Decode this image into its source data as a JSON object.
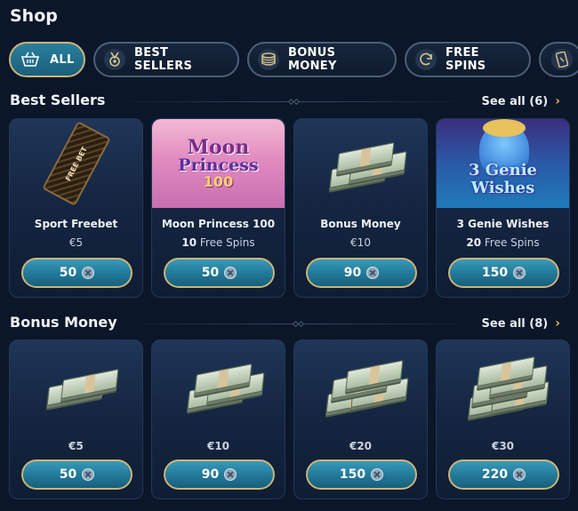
{
  "page": {
    "title": "Shop"
  },
  "filters": [
    {
      "label": "ALL",
      "icon": "basket-icon",
      "active": true
    },
    {
      "label": "BEST SELLERS",
      "icon": "medal-icon",
      "active": false
    },
    {
      "label": "BONUS MONEY",
      "icon": "coin-stack-icon",
      "active": false
    },
    {
      "label": "FREE SPINS",
      "icon": "refresh-icon",
      "active": false
    },
    {
      "label": "",
      "icon": "ticket-icon",
      "active": false
    }
  ],
  "best_sellers": {
    "title": "Best Sellers",
    "see_all": "See all (6)",
    "items": [
      {
        "name": "Sport Freebet",
        "value": "€5",
        "price": "50",
        "art": "freebet-ticket",
        "ticket_text": "FREE BET"
      },
      {
        "name": "Moon Princess 100",
        "count": "10",
        "count_label": "Free Spins",
        "price": "50",
        "art": "moon-princess",
        "art_text": {
          "line1": "Moon",
          "line2": "Princess",
          "line3": "100"
        }
      },
      {
        "name": "Bonus Money",
        "value": "€10",
        "price": "90",
        "art": "cash"
      },
      {
        "name": "3 Genie Wishes",
        "count": "20",
        "count_label": "Free Spins",
        "price": "150",
        "art": "genie",
        "art_text": {
          "line1": "3 Genie",
          "line2": "Wishes"
        }
      }
    ]
  },
  "bonus_money": {
    "title": "Bonus Money",
    "see_all": "See all (8)",
    "items": [
      {
        "value": "€5",
        "price": "50"
      },
      {
        "value": "€10",
        "price": "90"
      },
      {
        "value": "€20",
        "price": "150"
      },
      {
        "value": "€30",
        "price": "220"
      }
    ]
  },
  "colors": {
    "background": "#0b1628",
    "accent_gold": "#c9b57a",
    "button_teal": "#237a9a",
    "chevron": "#e6b84a"
  }
}
